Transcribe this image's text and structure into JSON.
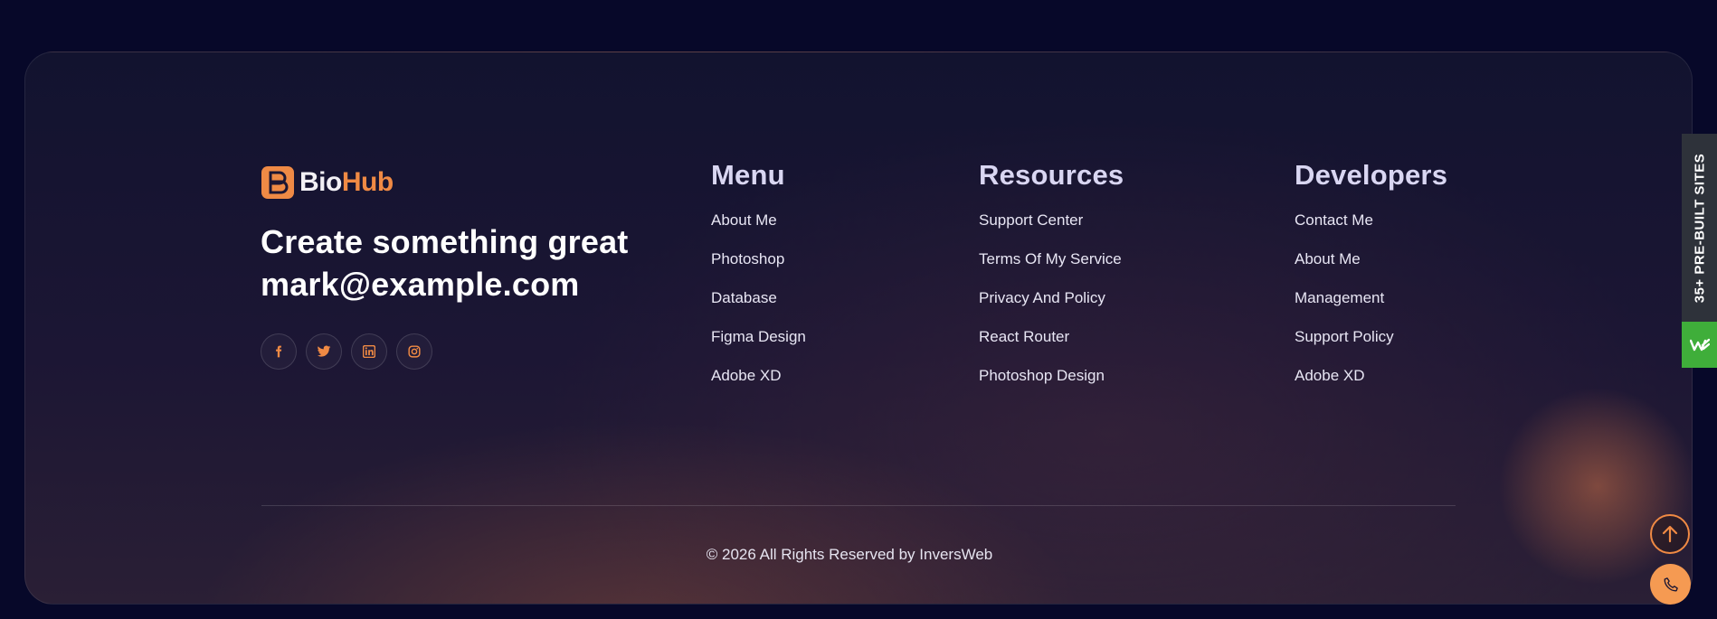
{
  "brand": {
    "name_part1": "Bio",
    "name_part2": "Hub",
    "logo_icon": "b-logo-icon",
    "accent_color": "#f08a44"
  },
  "tagline": {
    "line1": "Create something great",
    "line2": "mark@example.com"
  },
  "socials": [
    {
      "icon": "facebook-icon"
    },
    {
      "icon": "twitter-icon"
    },
    {
      "icon": "linkedin-icon"
    },
    {
      "icon": "instagram-icon"
    }
  ],
  "columns": {
    "menu": {
      "title": "Menu",
      "links": [
        "About Me",
        "Photoshop",
        "Database",
        "Figma Design",
        "Adobe XD"
      ]
    },
    "resources": {
      "title": "Resources",
      "links": [
        "Support Center",
        "Terms Of My Service",
        "Privacy And Policy",
        "React Router",
        "Photoshop Design"
      ]
    },
    "developers": {
      "title": "Developers",
      "links": [
        "Contact Me",
        "About Me",
        "Management",
        "Support Policy",
        "Adobe XD"
      ]
    }
  },
  "copyright": "© 2026 All Rights Reserved by InversWeb",
  "side_tab": {
    "label": "35+ PRE-BUILT SITES",
    "badge_icon": "wave-logo-icon",
    "badge_color": "#3fae3a"
  },
  "floating": {
    "scroll_top_icon": "arrow-up-icon",
    "phone_icon": "phone-icon"
  }
}
